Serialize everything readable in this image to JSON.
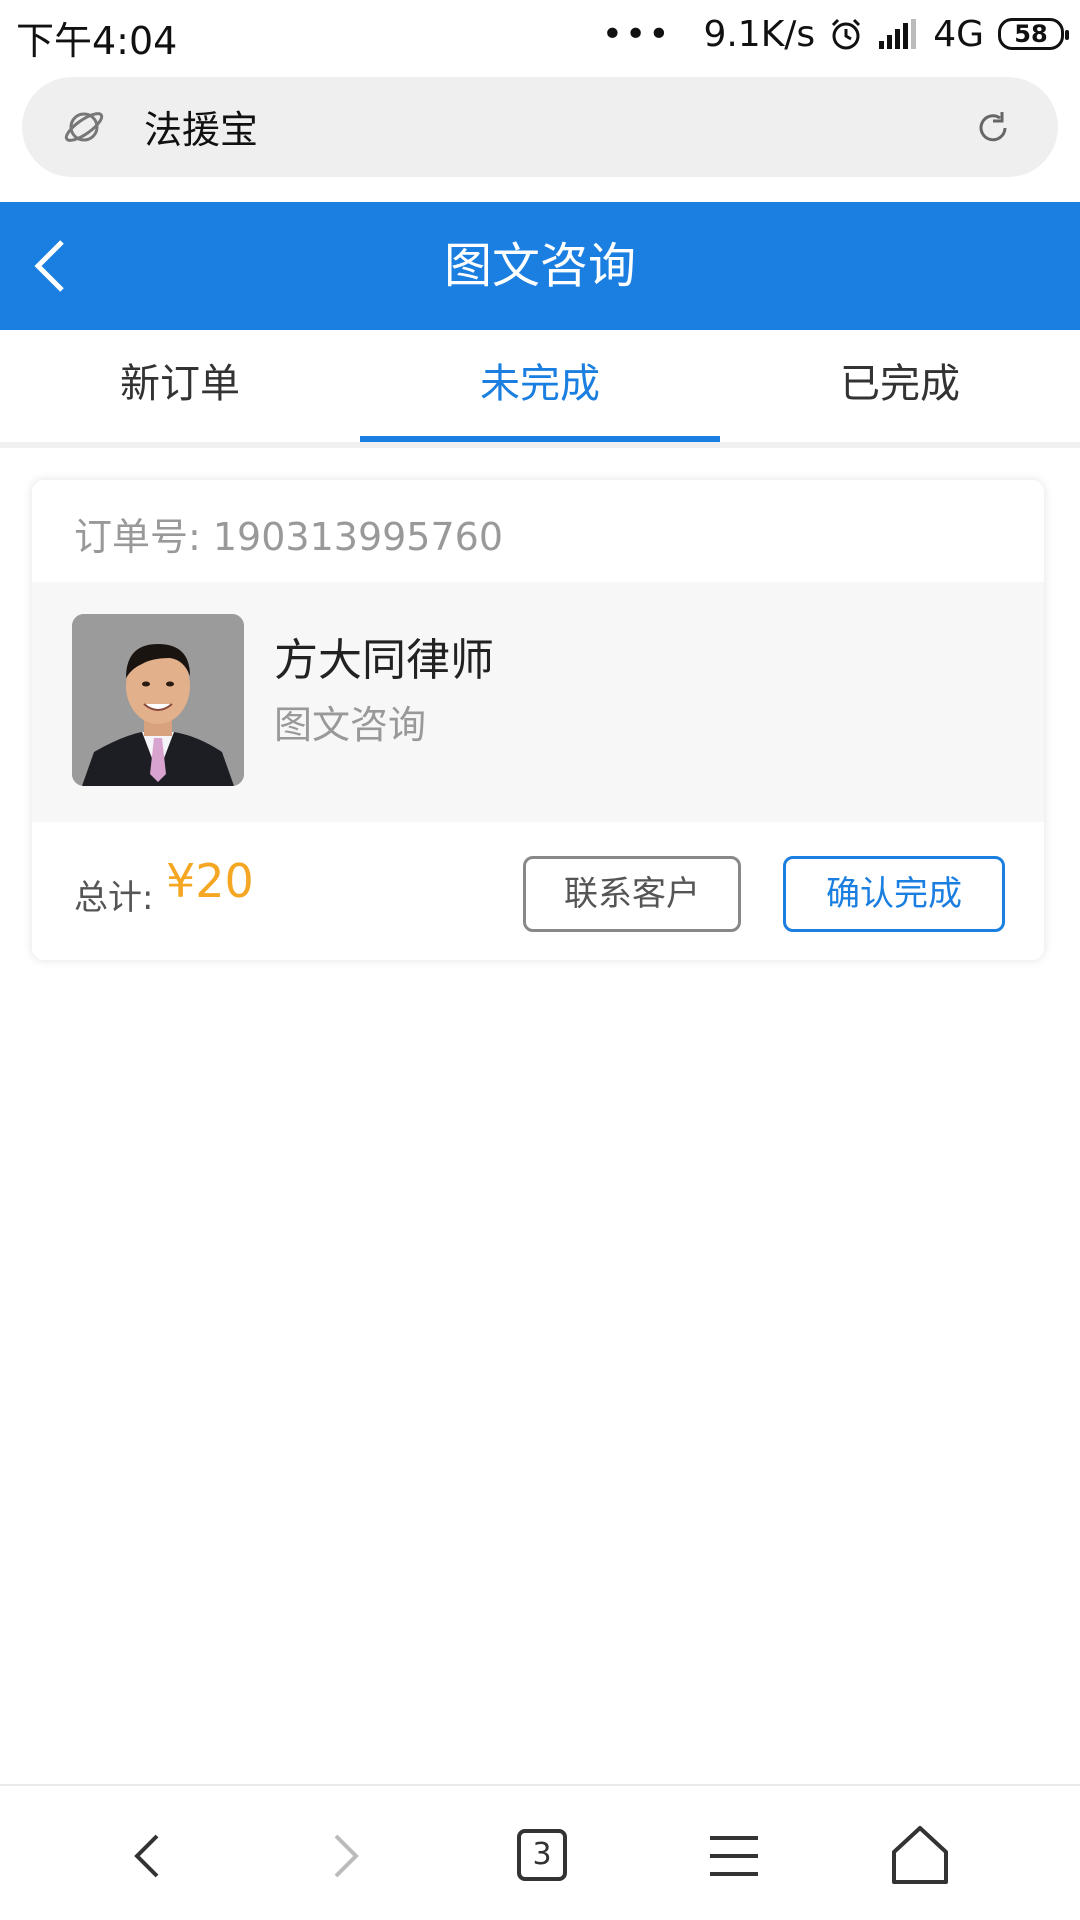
{
  "status_bar": {
    "time": "下午4:04",
    "dots": "•••",
    "speed": "9.1K/s",
    "network": "4G",
    "battery": "58"
  },
  "browser": {
    "address_text": "法援宝"
  },
  "header": {
    "title": "图文咨询"
  },
  "tabs": [
    {
      "label": "新订单",
      "active": false
    },
    {
      "label": "未完成",
      "active": true
    },
    {
      "label": "已完成",
      "active": false
    }
  ],
  "order": {
    "order_number_text": "订单号: 190313995760",
    "lawyer_name": "方大同律师",
    "service_type": "图文咨询",
    "total_label": "总计:",
    "total_price": "¥20",
    "contact_button": "联系客户",
    "confirm_button": "确认完成"
  },
  "bottom_nav": {
    "tab_count": "3",
    "icons": [
      "back-icon",
      "forward-icon",
      "tabs-icon",
      "menu-icon",
      "home-icon"
    ]
  },
  "colors": {
    "brand_blue": "#1a7fe0",
    "price_orange": "#f5a623"
  }
}
